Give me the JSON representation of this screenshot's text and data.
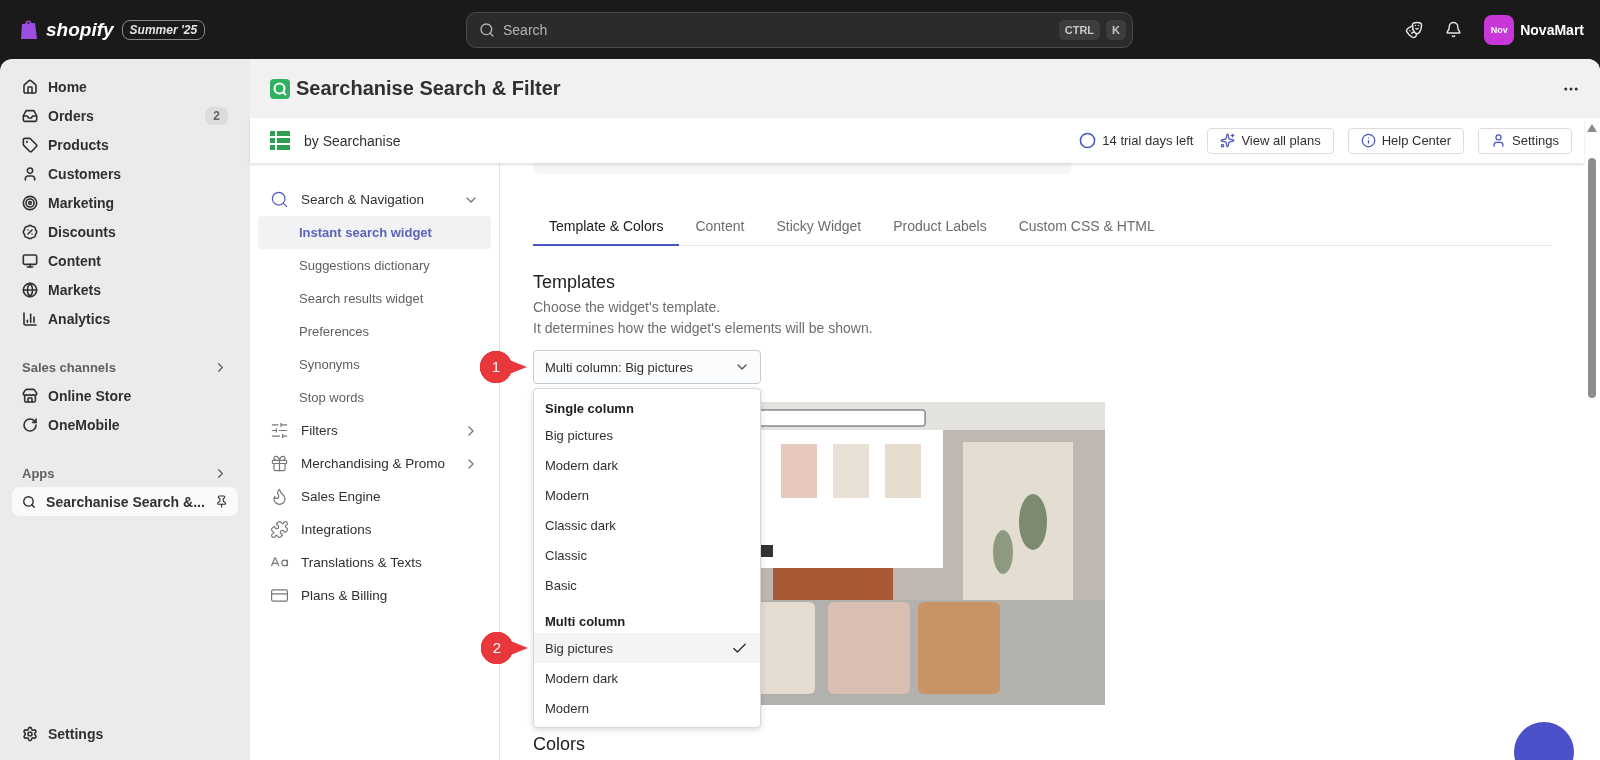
{
  "topbar": {
    "brand": "shopify",
    "edition": "Summer '25",
    "search": {
      "placeholder": "Search"
    },
    "shortcut": [
      "CTRL",
      "K"
    ],
    "store": {
      "avatar": "Nov",
      "name": "NovaMart"
    }
  },
  "sidebar": {
    "items": [
      {
        "label": "Home",
        "selected": false
      },
      {
        "label": "Orders",
        "badge": "2",
        "selected": false
      },
      {
        "label": "Products",
        "selected": false
      },
      {
        "label": "Customers",
        "selected": false
      },
      {
        "label": "Marketing",
        "selected": false
      },
      {
        "label": "Discounts",
        "selected": false
      },
      {
        "label": "Content",
        "selected": false
      },
      {
        "label": "Markets",
        "selected": false
      },
      {
        "label": "Analytics",
        "selected": false
      }
    ],
    "sections": [
      {
        "title": "Sales channels",
        "items": [
          {
            "label": "Online Store",
            "selected": false
          },
          {
            "label": "OneMobile",
            "selected": false
          }
        ]
      },
      {
        "title": "Apps",
        "items": [
          {
            "label": "Searchanise Search &...",
            "selected": true,
            "pinned": true
          }
        ]
      }
    ],
    "footer": {
      "label": "Settings"
    }
  },
  "app": {
    "title": "Searchanise Search & Filter",
    "vendor": "by Searchanise",
    "trial": "14 trial days left",
    "actions": [
      "View all plans",
      "Help Center",
      "Settings"
    ]
  },
  "app_nav": [
    {
      "label": "Search & Navigation",
      "expanded": true,
      "children": [
        {
          "label": "Instant search widget",
          "selected": true
        },
        {
          "label": "Suggestions dictionary",
          "selected": false
        },
        {
          "label": "Search results widget",
          "selected": false
        },
        {
          "label": "Preferences",
          "selected": false
        },
        {
          "label": "Synonyms",
          "selected": false
        },
        {
          "label": "Stop words",
          "selected": false
        }
      ]
    },
    {
      "label": "Filters",
      "expanded": false
    },
    {
      "label": "Merchandising & Promo",
      "expanded": false
    },
    {
      "label": "Sales Engine"
    },
    {
      "label": "Integrations"
    },
    {
      "label": "Translations & Texts"
    },
    {
      "label": "Plans & Billing"
    }
  ],
  "tabs": [
    {
      "label": "Template & Colors",
      "selected": true
    },
    {
      "label": "Content",
      "selected": false
    },
    {
      "label": "Sticky Widget",
      "selected": false
    },
    {
      "label": "Product Labels",
      "selected": false
    },
    {
      "label": "Custom CSS & HTML",
      "selected": false
    }
  ],
  "templates": {
    "heading": "Templates",
    "description": [
      "Choose the widget's template.",
      "It determines how the widget's elements will be shown."
    ],
    "select": {
      "value": "Multi column: Big pictures",
      "expanded": true,
      "callout": "1"
    },
    "groups": [
      {
        "title": "Single column",
        "options": [
          {
            "label": "Big pictures",
            "selected": false
          },
          {
            "label": "Modern dark",
            "selected": false
          },
          {
            "label": "Modern",
            "selected": false
          },
          {
            "label": "Classic dark",
            "selected": false
          },
          {
            "label": "Classic",
            "selected": false
          },
          {
            "label": "Basic",
            "selected": false
          }
        ]
      },
      {
        "title": "Multi column",
        "options": [
          {
            "label": "Big pictures",
            "selected": true,
            "callout": "2"
          },
          {
            "label": "Modern dark",
            "selected": false
          },
          {
            "label": "Modern",
            "selected": false
          }
        ]
      }
    ],
    "preview": {
      "kind": "picture"
    }
  },
  "colors": {
    "heading": "Colors"
  }
}
